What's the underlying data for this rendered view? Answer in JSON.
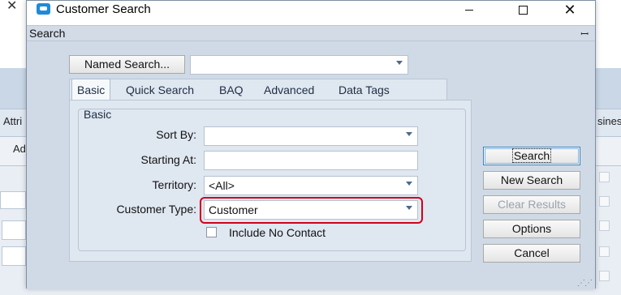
{
  "background": {
    "close_glyph": "✕",
    "fragments": [
      "Attri",
      "Ad",
      "sines"
    ]
  },
  "dialog": {
    "title": "Customer Search",
    "window_controls": {
      "minimize": "minimize-icon",
      "maximize": "maximize-icon",
      "close": "✕"
    },
    "panel_label": "Search",
    "pin_glyph": "ꟷ",
    "named_search_label": "Named Search...",
    "named_search_value": "",
    "tabs": [
      {
        "label": "Basic",
        "active": true
      },
      {
        "label": "Quick Search",
        "active": false
      },
      {
        "label": "BAQ",
        "active": false
      },
      {
        "label": "Advanced",
        "active": false
      },
      {
        "label": "Data Tags",
        "active": false
      }
    ],
    "group_title": "Basic",
    "fields": {
      "sort_by": {
        "label": "Sort By:",
        "value": ""
      },
      "starting_at": {
        "label": "Starting At:",
        "value": ""
      },
      "territory": {
        "label": "Territory:",
        "value": "<All>"
      },
      "customer_type": {
        "label": "Customer Type:",
        "value": "Customer"
      }
    },
    "include_no_contact": {
      "label": "Include No Contact",
      "checked": false
    },
    "buttons": {
      "search": "Search",
      "new_search": "New Search",
      "clear_results": "Clear Results",
      "options": "Options",
      "cancel": "Cancel"
    },
    "grip": "⋰⋰",
    "colors": {
      "highlight": "#d0021b",
      "panel_bg": "#cfdae6"
    }
  }
}
